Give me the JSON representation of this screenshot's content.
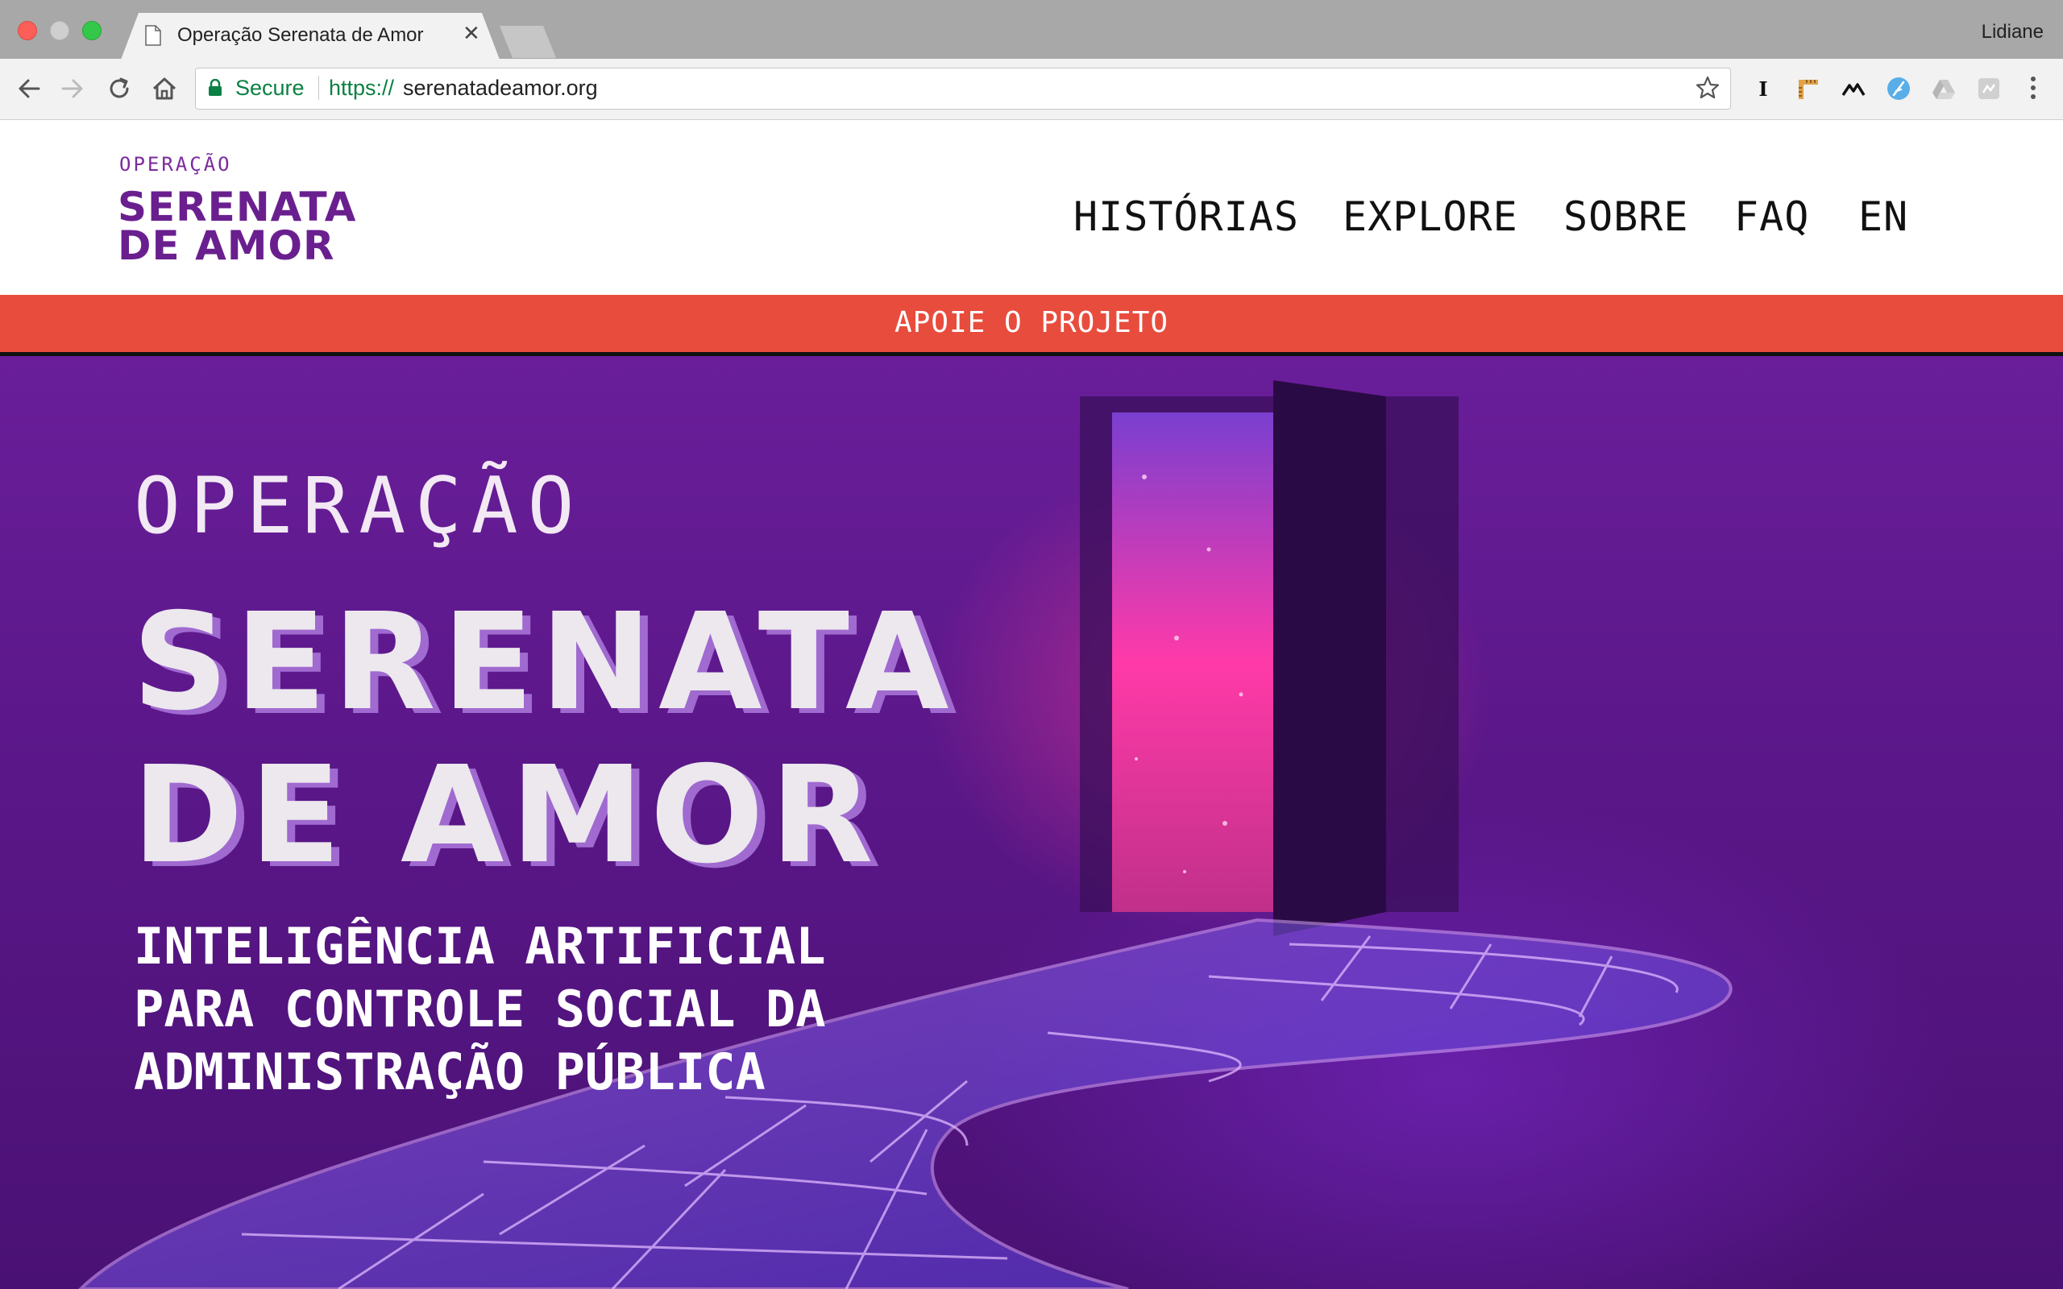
{
  "browser": {
    "tab_title": "Operação Serenata de Amor",
    "tab_close": "✕",
    "profile_name": "Lidiane",
    "secure_label": "Secure",
    "url_scheme": "https://",
    "url_host": "serenatadeamor.org",
    "extension_letter": "I"
  },
  "site": {
    "logo": {
      "small": "OPERAÇÃO",
      "line1": "SERENATA",
      "line2": "DE AMOR"
    },
    "nav": [
      "HISTÓRIAS",
      "EXPLORE",
      "SOBRE",
      "FAQ",
      "EN"
    ],
    "banner": "APOIE O PROJETO",
    "hero": {
      "kicker": "OPERAÇÃO",
      "title_line1": "SERENATA",
      "title_line2": "DE AMOR",
      "subtitle_lines": [
        "INTELIGÊNCIA ARTIFICIAL",
        "PARA CONTROLE SOCIAL DA",
        "ADMINISTRAÇÃO PÚBLICA"
      ]
    }
  },
  "colors": {
    "brand_purple": "#6a1f8f",
    "banner_red": "#e84c3d",
    "secure_green": "#0b8043"
  }
}
